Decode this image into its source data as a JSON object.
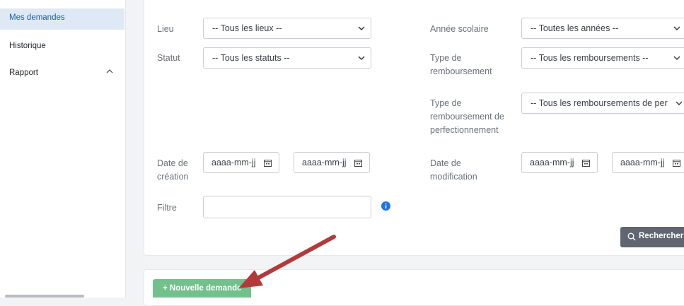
{
  "sidebar": {
    "items": [
      {
        "label": "Mes demandes"
      },
      {
        "label": "Historique"
      },
      {
        "label": "Rapport"
      }
    ]
  },
  "filters": {
    "lieu_label": "Lieu",
    "lieu_value": "-- Tous les lieux --",
    "annee_label": "Année scolaire",
    "annee_value": "-- Toutes les années --",
    "statut_label": "Statut",
    "statut_value": "-- Tous les statuts --",
    "type_label_1": "Type de",
    "type_label_2": "remboursement",
    "type_value": "-- Tous les remboursements --",
    "perf_label_1": "Type de",
    "perf_label_2": "remboursement de",
    "perf_label_3": "perfectionnement",
    "perf_value": "-- Tous les remboursements de per",
    "creation_label_1": "Date de",
    "creation_label_2": "création",
    "modif_label_1": "Date de",
    "modif_label_2": "modification",
    "date_placeholder": "aaaa-mm-jj",
    "filtre_label": "Filtre",
    "filtre_value": ""
  },
  "buttons": {
    "search_label": "Rechercher",
    "new_label": "+ Nouvelle demande"
  },
  "colors": {
    "accent_active": "#1f5c9c",
    "active_bg": "#dfe9f6",
    "new_button": "#72c08b",
    "search_button": "#5f6670",
    "info_icon": "#1a73e8",
    "annotation_arrow": "#b23a3a"
  }
}
